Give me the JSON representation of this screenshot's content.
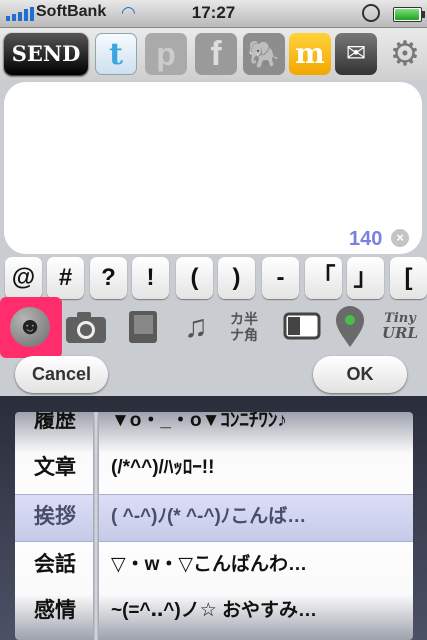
{
  "status_bar": {
    "carrier": "SoftBank",
    "time": "17:27"
  },
  "toolbar": {
    "send_label": "SEND",
    "services": [
      {
        "name": "twitter",
        "label": "t"
      },
      {
        "name": "plurk",
        "label": "p"
      },
      {
        "name": "facebook",
        "label": "f"
      },
      {
        "name": "evernote",
        "label": "🐘"
      },
      {
        "name": "mixi",
        "label": "m"
      },
      {
        "name": "mail",
        "label": "✉"
      }
    ]
  },
  "compose": {
    "text": "",
    "char_count": "140"
  },
  "symbol_keys": [
    "@",
    "#",
    "?",
    "!",
    "(",
    ")",
    "-",
    "「",
    "」",
    "["
  ],
  "tools": {
    "kana_top": "カ半",
    "kana_bottom": "ナ角",
    "tiny": "Tiny",
    "url": "URL"
  },
  "buttons": {
    "cancel": "Cancel",
    "ok": "OK"
  },
  "picker": {
    "rows": [
      {
        "category": "履歴",
        "text": "▼o・_・o▼ｺﾝﾆﾁﾜﾝ♪"
      },
      {
        "category": "文章",
        "text": "(/*^^)/ﾊｯﾛｰ!!"
      },
      {
        "category": "挨拶",
        "text": "( ^-^)ﾉ(* ^-^)ﾉこんば…",
        "selected": true
      },
      {
        "category": "会話",
        "text": "▽・w・▽こんばんわ…"
      },
      {
        "category": "感情",
        "text": "~(=^‥^)ノ☆ おやすみ…"
      }
    ]
  },
  "colors": {
    "highlight": "#ff2d6c",
    "counter": "#7a7fe0",
    "mixi": "#f2a800",
    "twitter": "#3aa6e0"
  }
}
